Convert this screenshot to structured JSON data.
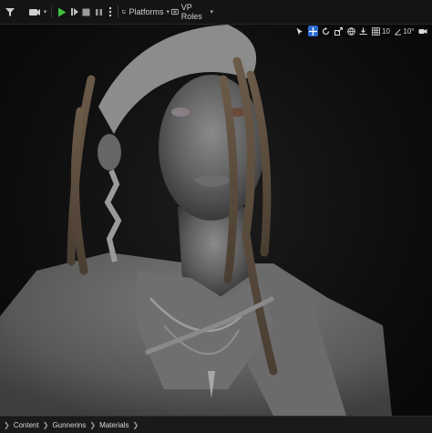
{
  "toolbar": {
    "platforms_label": "Platforms",
    "vp_roles_label": "VP Roles"
  },
  "viewport_tools": {
    "grid_snap_value": "10",
    "rotation_snap_value": "10°"
  },
  "breadcrumb": {
    "items": [
      "Content",
      "Gunnerins",
      "Materials"
    ]
  },
  "colors": {
    "toolbar_bg": "#141414",
    "play_green": "#3fbf3f",
    "accent_blue": "#2b6ad0",
    "viewport_bg": "#0e0e0e"
  },
  "icons": [
    "filter-icon",
    "camera-icon",
    "play-icon",
    "step-icon",
    "stop-icon",
    "more-icon",
    "platforms-icon",
    "vp-roles-icon",
    "select-icon",
    "move-icon",
    "rotate-icon",
    "scale-icon",
    "world-icon",
    "surface-snap-icon",
    "grid-snap-icon",
    "rotation-snap-icon",
    "camera-speed-icon"
  ]
}
